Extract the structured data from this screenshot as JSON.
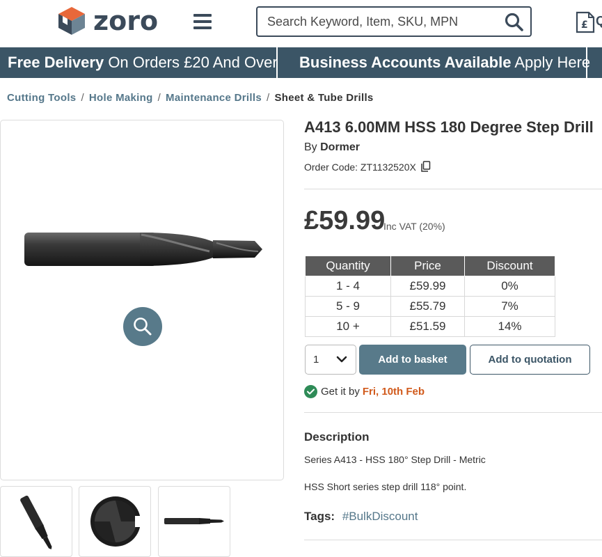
{
  "header": {
    "logo_text": "zoro",
    "search_placeholder": "Search Keyword, Item, SKU, MPN",
    "quote_partial": "Q"
  },
  "promo": {
    "item1_bold": "Free Delivery",
    "item1_rest": " On Orders £20 And Over",
    "item2_bold": "Business Accounts Available",
    "item2_rest": " Apply Here"
  },
  "breadcrumb": {
    "items": [
      "Cutting Tools",
      "Hole Making",
      "Maintenance Drills"
    ],
    "separator": "/",
    "current": "Sheet & Tube Drills"
  },
  "product": {
    "title": "A413 6.00MM HSS 180 Degree Step Drill",
    "by_label": "By",
    "brand": "Dormer",
    "order_code": "Order Code: ZT1132520X",
    "price": "£59.99",
    "vat_note": "Inc VAT (20%)"
  },
  "price_table": {
    "headers": [
      "Quantity",
      "Price",
      "Discount"
    ],
    "rows": [
      [
        "1 - 4",
        "£59.99",
        "0%"
      ],
      [
        "5 - 9",
        "£55.79",
        "7%"
      ],
      [
        "10 +",
        "£51.59",
        "14%"
      ]
    ]
  },
  "actions": {
    "quantity": "1",
    "add_to_basket": "Add to basket",
    "add_to_quotation": "Add to quotation"
  },
  "delivery": {
    "label": "Get it by",
    "date": "Fri, 10th Feb"
  },
  "description": {
    "heading": "Description",
    "line1": "Series A413 - HSS 180° Step Drill - Metric",
    "line2": "HSS Short series step drill 118° point."
  },
  "tags": {
    "label": "Tags:",
    "items": [
      "#BulkDiscount"
    ]
  },
  "colors": {
    "brand_dark": "#3b4a5a",
    "promo_bg": "#3b5566",
    "accent": "#587a8a",
    "logo_orange": "#e8683a",
    "delivery_date": "#d15a1c",
    "success": "#2e8b57"
  },
  "icons": [
    "menu-icon",
    "search-icon",
    "quote-icon",
    "copy-icon",
    "zoom-icon",
    "chevron-down-icon",
    "check-icon"
  ]
}
